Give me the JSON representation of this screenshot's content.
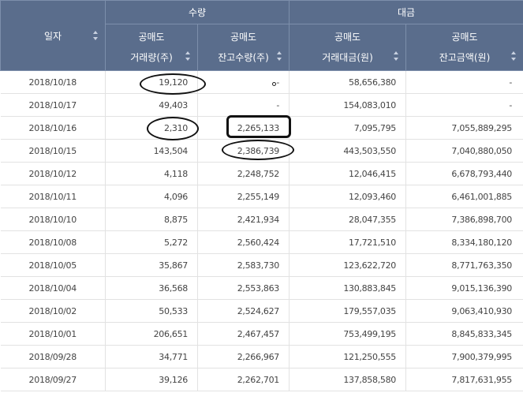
{
  "header": {
    "date": "일자",
    "group_volume": "수량",
    "group_amount": "대금",
    "sub": [
      {
        "l1": "공매도",
        "l2": "거래량(주)"
      },
      {
        "l1": "공매도",
        "l2": "잔고수량(주)"
      },
      {
        "l1": "공매도",
        "l2": "거래대금(원)"
      },
      {
        "l1": "공매도",
        "l2": "잔고금액(원)"
      }
    ]
  },
  "rows": [
    {
      "date": "2018/10/18",
      "vol": "19,120",
      "bal_qty": "-",
      "amt": "58,656,380",
      "bal_amt": "-"
    },
    {
      "date": "2018/10/17",
      "vol": "49,403",
      "bal_qty": "-",
      "amt": "154,083,010",
      "bal_amt": "-"
    },
    {
      "date": "2018/10/16",
      "vol": "2,310",
      "bal_qty": "2,265,133",
      "amt": "7,095,795",
      "bal_amt": "7,055,889,295"
    },
    {
      "date": "2018/10/15",
      "vol": "143,504",
      "bal_qty": "2,386,739",
      "amt": "443,503,550",
      "bal_amt": "7,040,880,050"
    },
    {
      "date": "2018/10/12",
      "vol": "4,118",
      "bal_qty": "2,248,752",
      "amt": "12,046,415",
      "bal_amt": "6,678,793,440"
    },
    {
      "date": "2018/10/11",
      "vol": "4,096",
      "bal_qty": "2,255,149",
      "amt": "12,093,460",
      "bal_amt": "6,461,001,885"
    },
    {
      "date": "2018/10/10",
      "vol": "8,875",
      "bal_qty": "2,421,934",
      "amt": "28,047,355",
      "bal_amt": "7,386,898,700"
    },
    {
      "date": "2018/10/08",
      "vol": "5,272",
      "bal_qty": "2,560,424",
      "amt": "17,721,510",
      "bal_amt": "8,334,180,120"
    },
    {
      "date": "2018/10/05",
      "vol": "35,867",
      "bal_qty": "2,583,730",
      "amt": "123,622,720",
      "bal_amt": "8,771,763,350"
    },
    {
      "date": "2018/10/04",
      "vol": "36,568",
      "bal_qty": "2,553,863",
      "amt": "130,883,845",
      "bal_amt": "9,015,136,390"
    },
    {
      "date": "2018/10/02",
      "vol": "50,533",
      "bal_qty": "2,524,627",
      "amt": "179,557,035",
      "bal_amt": "9,063,410,930"
    },
    {
      "date": "2018/10/01",
      "vol": "206,651",
      "bal_qty": "2,467,457",
      "amt": "753,499,195",
      "bal_amt": "8,845,833,345"
    },
    {
      "date": "2018/09/28",
      "vol": "34,771",
      "bal_qty": "2,266,967",
      "amt": "121,250,555",
      "bal_amt": "7,900,379,995"
    },
    {
      "date": "2018/09/27",
      "vol": "39,126",
      "bal_qty": "2,262,701",
      "amt": "137,858,580",
      "bal_amt": "7,817,631,955"
    }
  ]
}
